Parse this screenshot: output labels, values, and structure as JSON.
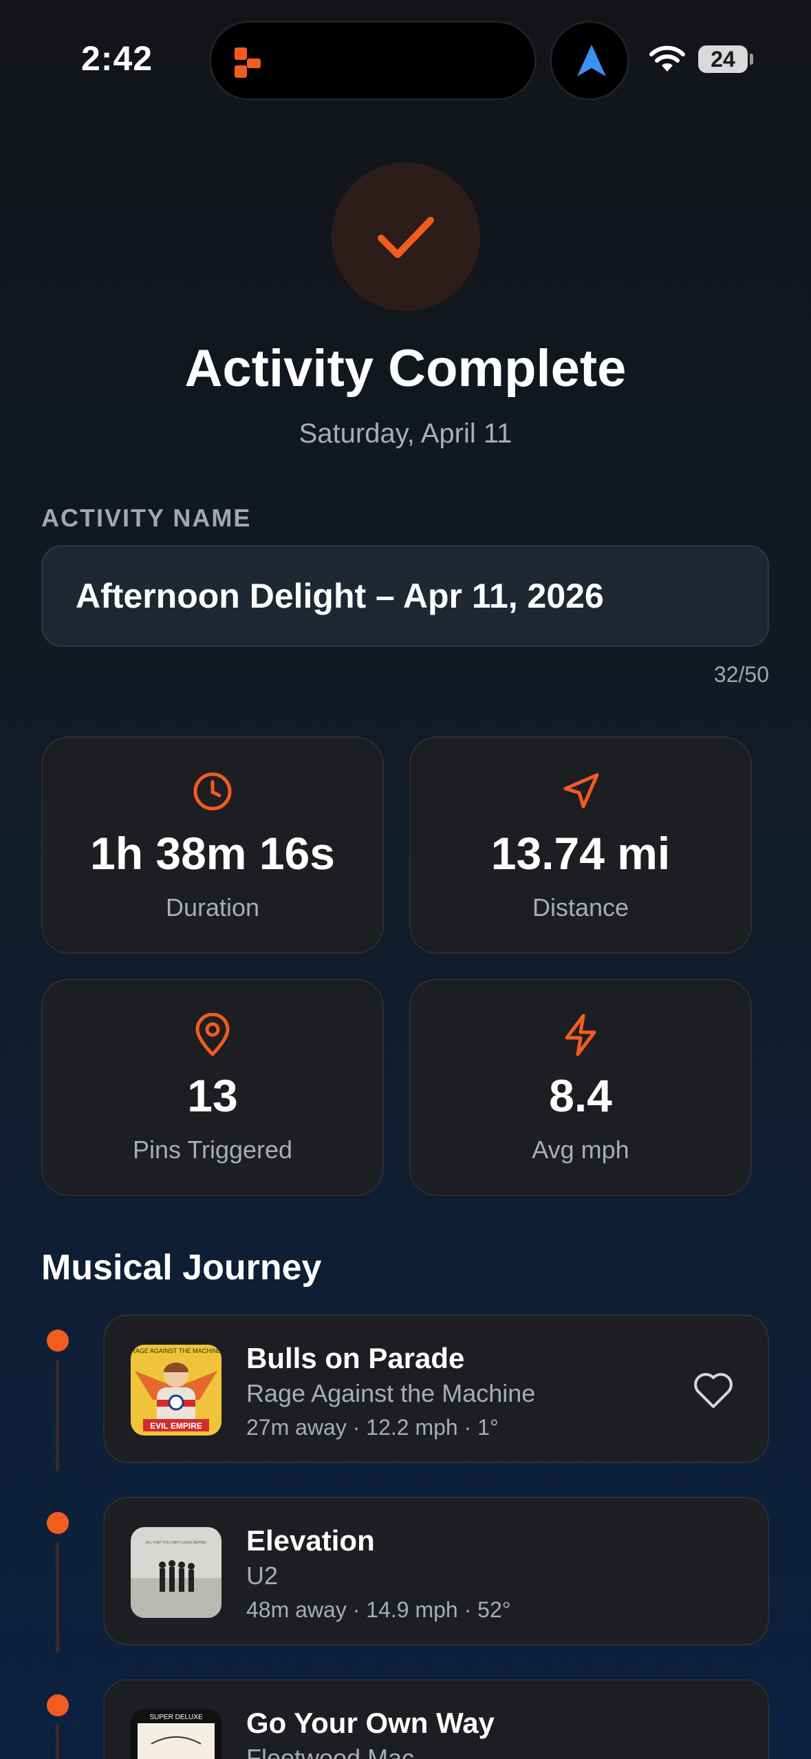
{
  "status_bar": {
    "time": "2:42",
    "battery": "24",
    "icons": [
      "app-activity-icon",
      "navigation-arrow-icon",
      "wifi-icon",
      "battery-icon"
    ]
  },
  "header": {
    "icon": "checkmark-icon",
    "title": "Activity Complete",
    "date": "Saturday, April 11"
  },
  "activity_name": {
    "label": "ACTIVITY NAME",
    "value": "Afternoon Delight – Apr 11, 2026",
    "char_count": "32/50"
  },
  "stats": [
    {
      "icon": "clock-icon",
      "value": "1h 38m 16s",
      "label": "Duration"
    },
    {
      "icon": "navigation-icon",
      "value": "13.74 mi",
      "label": "Distance"
    },
    {
      "icon": "map-pin-icon",
      "value": "13",
      "label": "Pins Triggered"
    },
    {
      "icon": "lightning-icon",
      "value": "8.4",
      "label": "Avg mph"
    }
  ],
  "journey": {
    "heading": "Musical Journey",
    "tracks": [
      {
        "title": "Bulls on Parade",
        "artist": "Rage Against the Machine",
        "meta": "27m away · 12.2 mph · 1°",
        "art_text": "RAGE AGAINST THE MACHINE",
        "art_badge": "EVIL EMPIRE"
      },
      {
        "title": "Elevation",
        "artist": "U2",
        "meta": "48m away · 14.9 mph · 52°",
        "art_text": "ALL THAT YOU CAN'T LEAVE BEHIND"
      },
      {
        "title": "Go Your Own Way",
        "artist": "Fleetwood Mac",
        "meta": "",
        "art_text": "SUPER DELUXE"
      }
    ]
  },
  "colors": {
    "accent": "#f25c1e",
    "card_bg": "#1c1e22",
    "muted_text": "#a9adb4"
  }
}
